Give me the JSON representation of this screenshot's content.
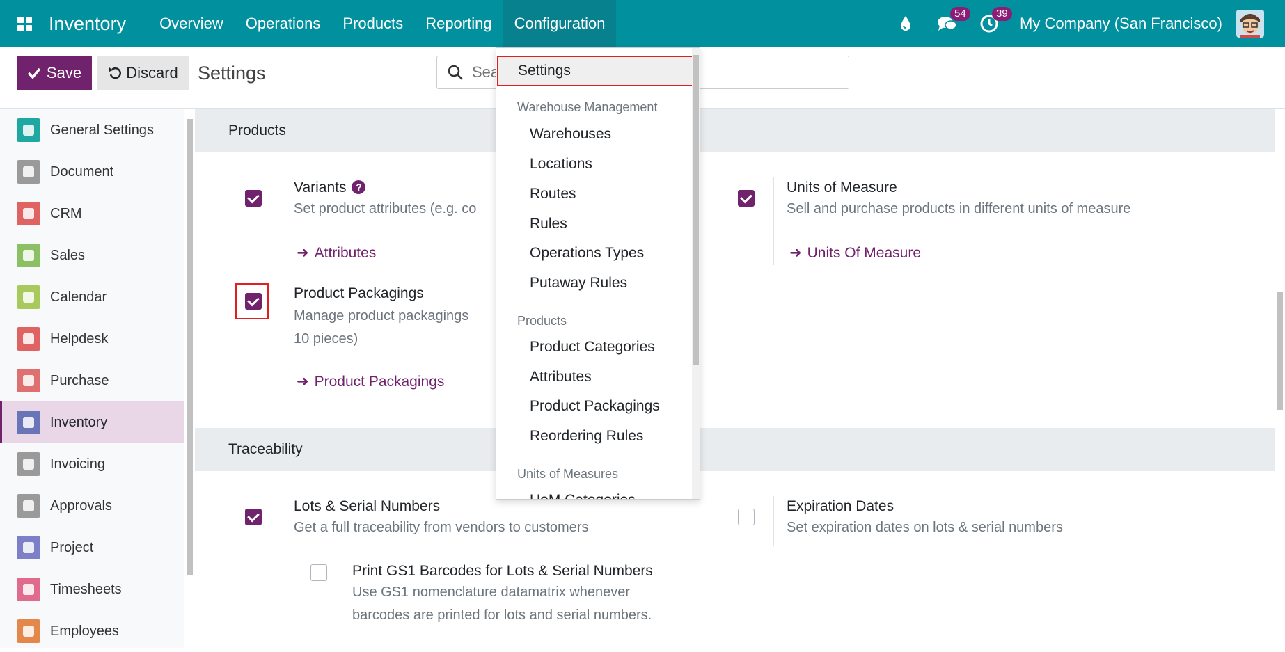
{
  "navbar": {
    "brand": "Inventory",
    "menu": [
      "Overview",
      "Operations",
      "Products",
      "Reporting",
      "Configuration"
    ],
    "active_menu": "Configuration",
    "messages_count": "54",
    "activities_count": "39",
    "company": "My Company (San Francisco)"
  },
  "control_panel": {
    "save_label": "Save",
    "discard_label": "Discard",
    "title": "Settings",
    "search_placeholder": "Search..."
  },
  "sidebar": {
    "items": [
      {
        "label": "General Settings",
        "icon": "gear-icon",
        "color": "#1fa7a1"
      },
      {
        "label": "Document",
        "icon": "folder-icon",
        "color": "#9a9a9a"
      },
      {
        "label": "CRM",
        "icon": "handshake-icon",
        "color": "#e06363"
      },
      {
        "label": "Sales",
        "icon": "chart-icon",
        "color": "#8cc064"
      },
      {
        "label": "Calendar",
        "icon": "calendar-icon",
        "color": "#a8c95b"
      },
      {
        "label": "Helpdesk",
        "icon": "helpdesk-icon",
        "color": "#e06363"
      },
      {
        "label": "Purchase",
        "icon": "credit-card-icon",
        "color": "#e07070"
      },
      {
        "label": "Inventory",
        "icon": "box-icon",
        "color": "#6a75b8"
      },
      {
        "label": "Invoicing",
        "icon": "invoice-icon",
        "color": "#9a9a9a"
      },
      {
        "label": "Approvals",
        "icon": "approvals-icon",
        "color": "#9a9a9a"
      },
      {
        "label": "Project",
        "icon": "rocket-icon",
        "color": "#7d7fc9"
      },
      {
        "label": "Timesheets",
        "icon": "timesheet-icon",
        "color": "#e06b8c"
      },
      {
        "label": "Employees",
        "icon": "people-icon",
        "color": "#e4874b"
      }
    ],
    "active": "Inventory"
  },
  "sections": {
    "products": {
      "title": "Products",
      "variants": {
        "title": "Variants",
        "desc": "Set product attributes (e.g. co",
        "link": "Attributes",
        "checked": true
      },
      "uom": {
        "title": "Units of Measure",
        "desc": "Sell and purchase products in different units of measure",
        "link": "Units Of Measure",
        "checked": true
      },
      "packagings": {
        "title": "Product Packagings",
        "desc1": "Manage product packagings",
        "desc2": "10 pieces)",
        "link": "Product Packagings",
        "checked": true
      }
    },
    "traceability": {
      "title": "Traceability",
      "lots": {
        "title": "Lots & Serial Numbers",
        "desc": "Get a full traceability from vendors to customers",
        "checked": true
      },
      "expiration": {
        "title": "Expiration Dates",
        "desc": "Set expiration dates on lots & serial numbers",
        "checked": false
      },
      "gs1": {
        "title": "Print GS1 Barcodes for Lots & Serial Numbers",
        "desc1": "Use GS1 nomenclature datamatrix whenever",
        "desc2": "barcodes are printed for lots and serial numbers.",
        "checked": false
      }
    }
  },
  "dropdown": {
    "settings": "Settings",
    "warehouse_header": "Warehouse Management",
    "warehouse_items": [
      "Warehouses",
      "Locations",
      "Routes",
      "Rules",
      "Operations Types",
      "Putaway Rules"
    ],
    "products_header": "Products",
    "products_items": [
      "Product Categories",
      "Attributes",
      "Product Packagings",
      "Reordering Rules"
    ],
    "uom_header": "Units of Measures",
    "uom_items": [
      "UoM Categories"
    ]
  },
  "colors": {
    "navbar": "#00909e",
    "accent": "#71226d",
    "highlight": "#e02020"
  }
}
